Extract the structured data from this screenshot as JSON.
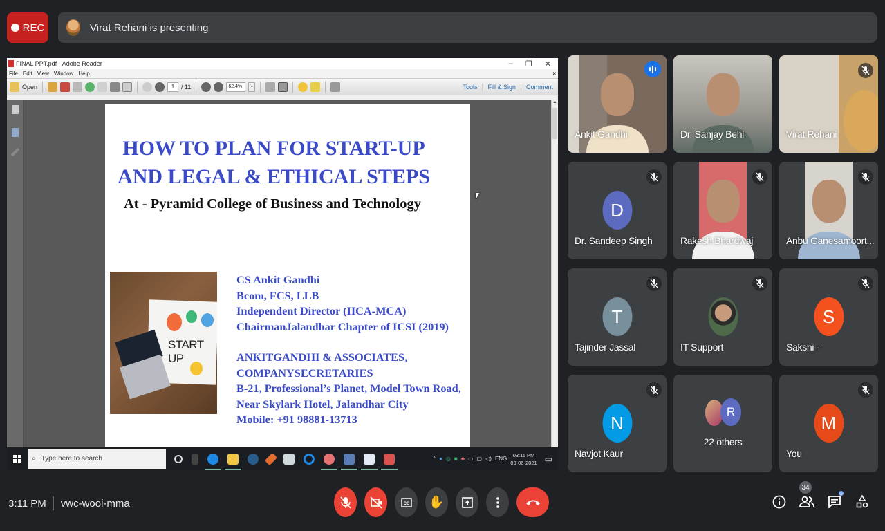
{
  "meet": {
    "rec_label": "REC",
    "presenting_text": "Virat Rehani is presenting",
    "time": "3:11 PM",
    "meeting_code": "vwc-wooi-mma",
    "participant_count": "34"
  },
  "adobe": {
    "window_title": "FINAL PPT.pdf - Adobe Reader",
    "menu": [
      "File",
      "Edit",
      "View",
      "Window",
      "Help"
    ],
    "open_label": "Open",
    "page_current": "1",
    "page_total": "/ 11",
    "zoom": "62.4%",
    "right_links": [
      "Tools",
      "Fill & Sign",
      "Comment"
    ]
  },
  "slide": {
    "title_line1": "HOW TO PLAN FOR START-UP",
    "title_line2": "AND LEGAL & ETHICAL STEPS",
    "subtitle": "At - Pyramid College of Business and Technology",
    "image_text": "START UP",
    "info1": [
      "CS Ankit Gandhi",
      "Bcom, FCS, LLB",
      "Independent Director (IICA-MCA)",
      "ChairmanJalandhar Chapter of ICSI (2019)"
    ],
    "info2": [
      "ANKITGANDHI & ASSOCIATES,",
      "COMPANYSECRETARIES",
      "B-21, Professional’s Planet, Model Town Road,",
      "Near Skylark Hotel, Jalandhar City",
      "Mobile: +91 98881-13713"
    ]
  },
  "taskbar": {
    "search_placeholder": "Type here to search",
    "lang": "ENG",
    "clock_time": "03:11 PM",
    "clock_date": "09-06-2021"
  },
  "tiles": [
    {
      "name": "Ankit Gandhi",
      "type": "video",
      "speaking": true
    },
    {
      "name": "Dr. Sanjay Behl",
      "type": "video"
    },
    {
      "name": "Virat Rehani",
      "type": "video",
      "muted": true
    },
    {
      "name": "Dr. Sandeep Singh",
      "initial": "D",
      "color": "#5c6bc0",
      "muted": true
    },
    {
      "name": "Rakesh Bhardwaj",
      "type": "video",
      "muted": true
    },
    {
      "name": "Anbu Ganesamoort...",
      "type": "video",
      "muted": true
    },
    {
      "name": "Tajinder Jassal",
      "initial": "T",
      "color": "#78909c",
      "muted": true
    },
    {
      "name": "IT Support",
      "type": "photo",
      "muted": true
    },
    {
      "name": "Sakshi -",
      "initial": "S",
      "color": "#f4511e",
      "muted": true
    },
    {
      "name": "Navjot Kaur",
      "initial": "N",
      "color": "#039be5",
      "muted": true
    },
    {
      "name": "22 others",
      "initial": "R",
      "color": "#5c6bc0"
    },
    {
      "name": "You",
      "initial": "M",
      "color": "#e64a19",
      "muted": true
    }
  ],
  "colors": {
    "accent_red": "#ea4335",
    "speaking_blue": "#1a73e8",
    "slide_blue": "#3b4bc8"
  }
}
